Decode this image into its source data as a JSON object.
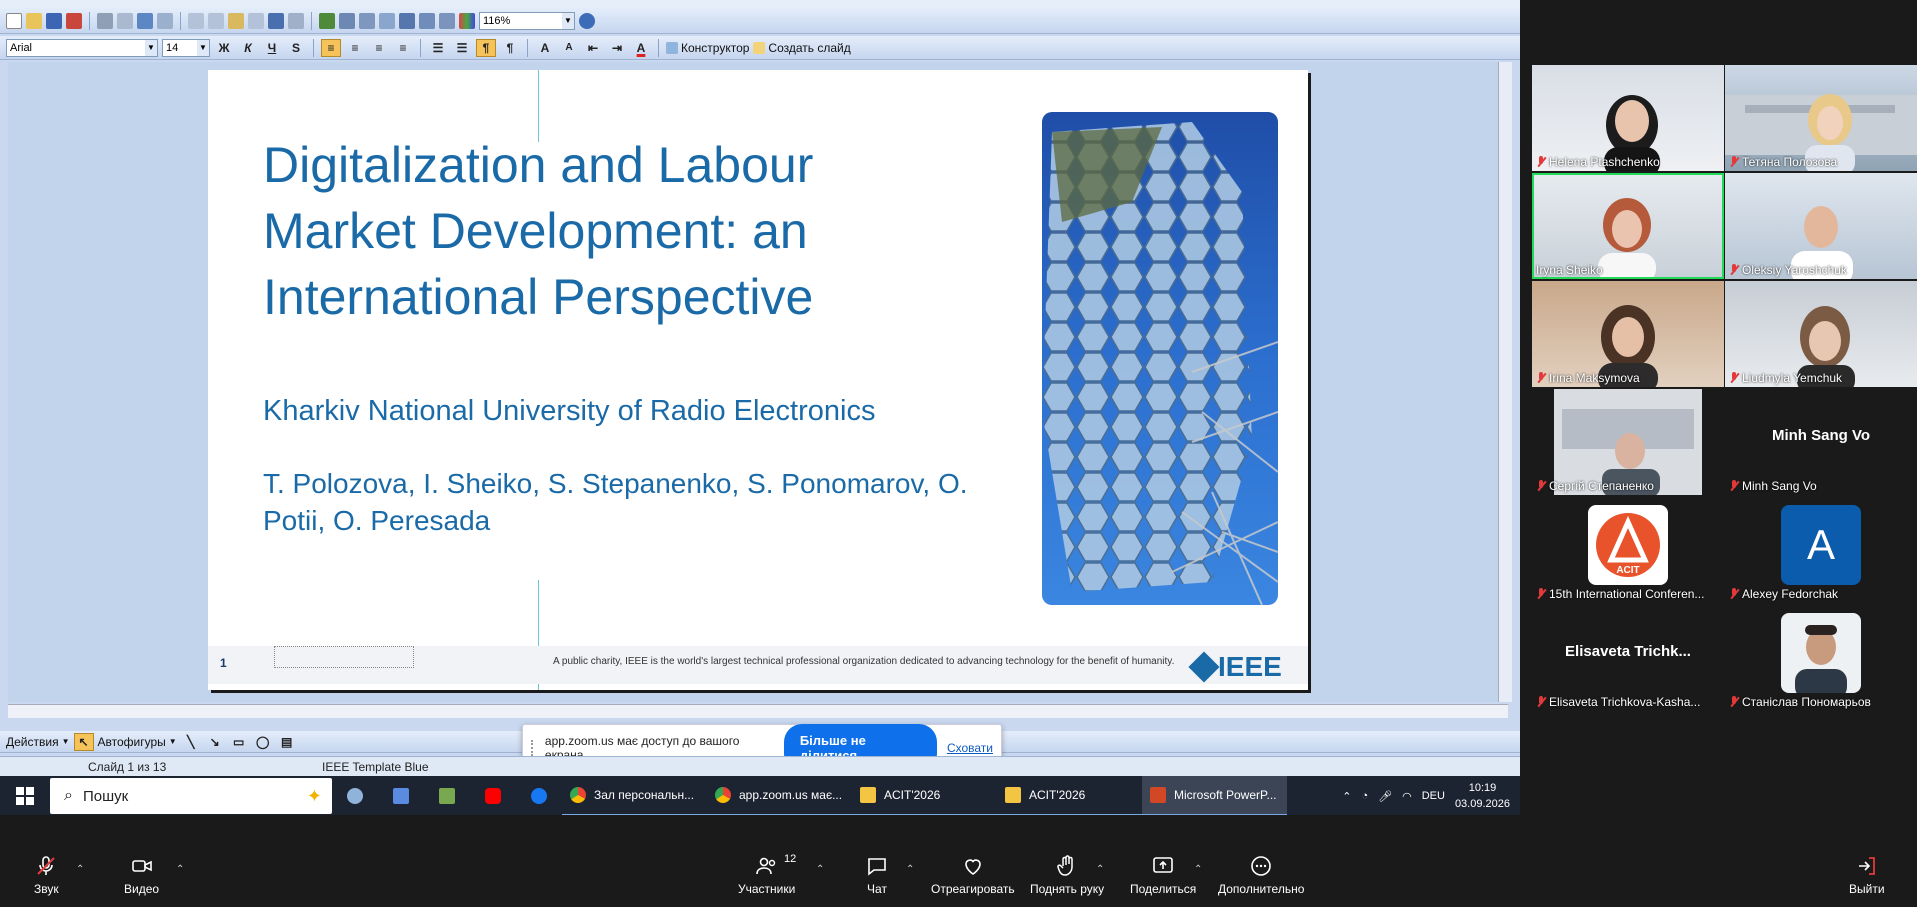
{
  "toolbar": {
    "zoom_value": "116%",
    "font_name": "Arial",
    "font_size": "14",
    "bold": "Ж",
    "italic": "К",
    "underline": "Ч",
    "shadow": "S",
    "constructor_label": "Конструктор",
    "new_slide_label": "Создать слайд",
    "actions_label": "Действия",
    "autoshapes_label": "Автофигуры"
  },
  "slide": {
    "title": "Digitalization and Labour Market Development: an International Perspective",
    "university": "Kharkiv National University of Radio Electronics",
    "authors": "T. Polozova, I. Sheiko, S. Stepanenko, S. Ponomarov, O. Potii, O. Peresada",
    "number": "1",
    "footer_text": "A public charity, IEEE is the world's largest technical professional organization dedicated to advancing technology for the benefit of humanity.",
    "logo_text": "IEEE"
  },
  "statusbar": {
    "slide_counter": "Слайд 1 из 13",
    "template": "IEEE Template Blue"
  },
  "share_notice": {
    "message": "app.zoom.us має доступ до вашого екрана.",
    "stop_button": "Більше не ділитися",
    "hide_link": "Сховати"
  },
  "taskbar": {
    "search_placeholder": "Пошук",
    "apps": [
      {
        "label": "Зал персональн...",
        "icon": "chrome-icon"
      },
      {
        "label": "app.zoom.us має...",
        "icon": "chrome-icon"
      },
      {
        "label": "ACIT'2026",
        "icon": "folder-icon"
      },
      {
        "label": "ACIT'2026",
        "icon": "folder-icon"
      },
      {
        "label": "Microsoft PowerP...",
        "icon": "powerpoint-icon"
      }
    ],
    "language": "DEU",
    "time": "10:19",
    "date": "03.09.2026"
  },
  "participants": [
    {
      "name": "Helena Ptashchenko",
      "kind": "video"
    },
    {
      "name": "Тетяна Полозова",
      "kind": "video"
    },
    {
      "name": "Iryna Sheiko",
      "kind": "video",
      "speaking": true
    },
    {
      "name": "Oleksiy Yaroshchuk",
      "kind": "video"
    },
    {
      "name": "Irina Maksymova",
      "kind": "video"
    },
    {
      "name": "Liudmyla Yemchuk",
      "kind": "video"
    },
    {
      "name": "Сергій Степаненко",
      "kind": "video"
    },
    {
      "name": "Minh Sang Vo",
      "kind": "name",
      "display": "Minh Sang Vo"
    },
    {
      "name": "15th International Conferen...",
      "kind": "logo",
      "avatar_text": "ACIT"
    },
    {
      "name": "Alexey Fedorchak",
      "kind": "avatar",
      "avatar_text": "A"
    },
    {
      "name": "Elisaveta Trichkova-Kasha...",
      "kind": "name",
      "display": "Elisaveta Trichk..."
    },
    {
      "name": "Станіслав Пономарьов",
      "kind": "video"
    }
  ],
  "zoom_controls": {
    "audio": "Звук",
    "video": "Видео",
    "participants": "Участники",
    "participants_count": "12",
    "chat": "Чат",
    "react": "Отреагировать",
    "raise_hand": "Поднять руку",
    "share": "Поделиться",
    "more": "Дополнительно",
    "leave": "Выйти"
  },
  "colors": {
    "slide_blue": "#1a6aa8",
    "zoom_blue": "#0e71eb",
    "speaker_outline": "#23d959",
    "muted_red": "#e23a3a"
  }
}
